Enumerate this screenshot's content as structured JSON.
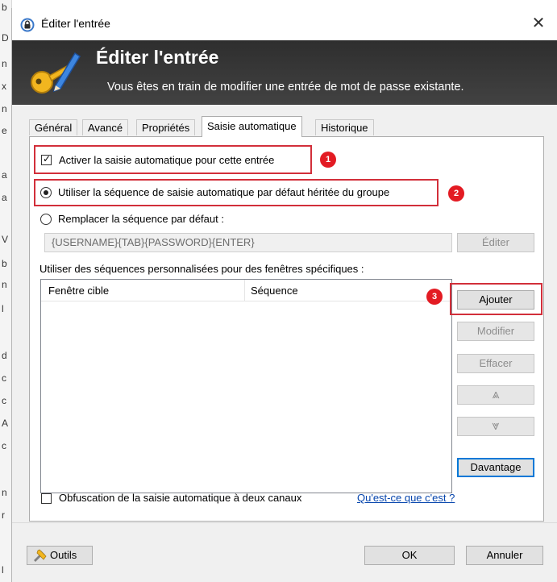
{
  "window": {
    "title": "Éditer l'entrée",
    "close_glyph": "✕"
  },
  "background_chars": [
    "b",
    "D",
    "n",
    "x",
    "n",
    "e",
    "a",
    "a",
    "V",
    "b",
    "n",
    "l",
    "d",
    "c",
    "c",
    "A",
    "c",
    "n",
    "r",
    "l"
  ],
  "banner": {
    "title": "Éditer l'entrée",
    "subtitle": "Vous êtes en train de modifier une entrée de mot de passe existante.",
    "icon": "key-pencil-icon"
  },
  "tabs": [
    {
      "label": "Général",
      "active": false
    },
    {
      "label": "Avancé",
      "active": false
    },
    {
      "label": "Propriétés",
      "active": false
    },
    {
      "label": "Saisie automatique",
      "active": true
    },
    {
      "label": "Historique",
      "active": false
    }
  ],
  "autotype": {
    "enable_label": "Activer la saisie automatique pour cette entrée",
    "enable_checked": true,
    "inherit_label": "Utiliser la séquence de saisie automatique par défaut héritée du groupe",
    "override_label": "Remplacer la séquence par défaut :",
    "sequence_value": "{USERNAME}{TAB}{PASSWORD}{ENTER}",
    "edit_button": "Éditer",
    "custom_label": "Utiliser des séquences personnalisées pour des fenêtres spécifiques :",
    "columns": [
      "Fenêtre cible",
      "Séquence"
    ],
    "buttons": {
      "add": "Ajouter",
      "modify": "Modifier",
      "delete": "Effacer",
      "up_glyph": "⩓",
      "down_glyph": "⩔",
      "more": "Davantage"
    },
    "obfuscation_label": "Obfuscation de la saisie automatique à deux canaux",
    "help_link": "Qu'est-ce que c'est ?"
  },
  "annotations": [
    "1",
    "2",
    "3"
  ],
  "footer": {
    "tools": "Outils",
    "ok": "OK",
    "cancel": "Annuler"
  },
  "colors": {
    "annotation_red": "#e31b23",
    "banner_bg": "#383838",
    "link": "#0645ad",
    "focus_blue": "#0078d7"
  }
}
